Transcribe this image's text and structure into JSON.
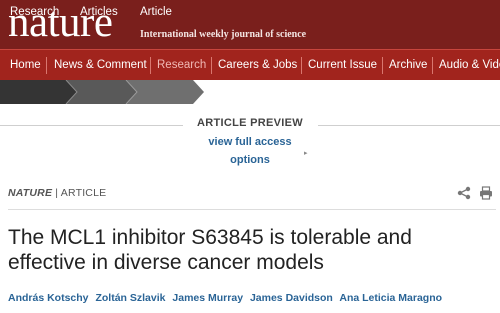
{
  "masthead": {
    "logo": "nature",
    "tagline": "International weekly journal of science"
  },
  "nav": {
    "items": [
      {
        "label": "Home"
      },
      {
        "label": "News & Comment"
      },
      {
        "label": "Research",
        "active": true
      },
      {
        "label": "Careers & Jobs"
      },
      {
        "label": "Current Issue"
      },
      {
        "label": "Archive"
      },
      {
        "label": "Audio & Video"
      }
    ]
  },
  "breadcrumb": [
    {
      "label": "Research"
    },
    {
      "label": "Articles"
    },
    {
      "label": "Article"
    }
  ],
  "preview": {
    "heading": "ARTICLE PREVIEW",
    "access_line1": "view full access",
    "access_line2": "options"
  },
  "article": {
    "journal": "NATURE",
    "separator": "|",
    "type": "ARTICLE",
    "title": "The MCL1 inhibitor S63845 is tolerable and effective in diverse cancer models",
    "authors": [
      "András Kotschy",
      "Zoltán Szlavik",
      "James Murray",
      "James Davidson",
      "Ana Leticia Maragno"
    ]
  },
  "icons": {
    "share": "share-icon",
    "print": "print-icon"
  },
  "colors": {
    "masthead": "#7a1f1c",
    "nav": "#a1241d",
    "link": "#2a6496",
    "breadcrumb_dark": "#343434"
  }
}
